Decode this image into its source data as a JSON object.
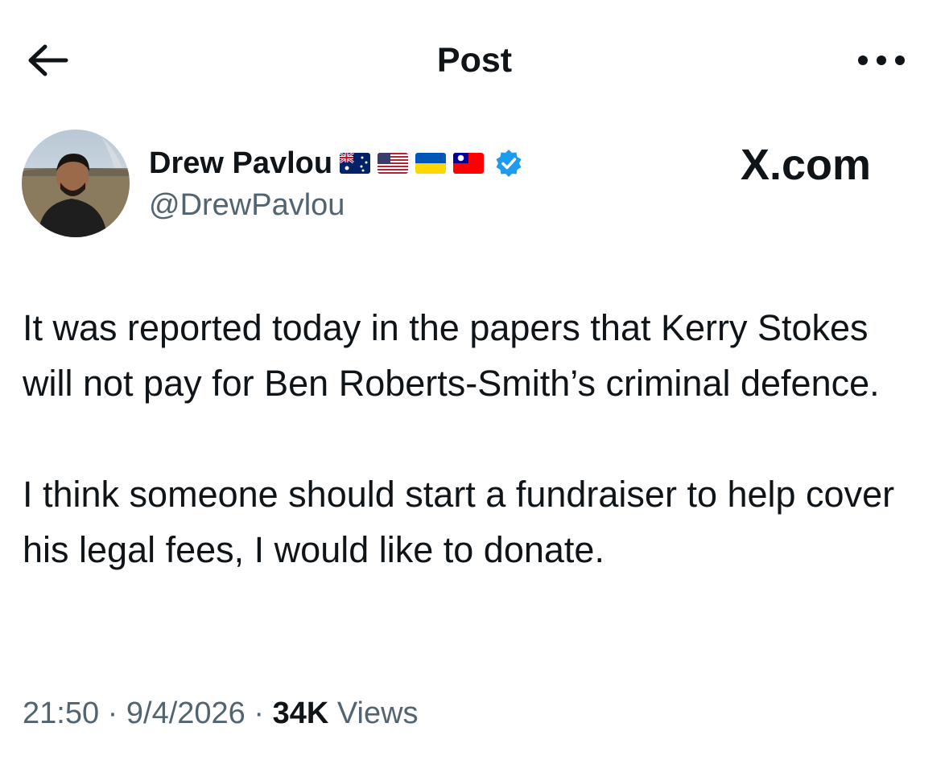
{
  "header": {
    "title": "Post",
    "back_icon": "arrow-left-icon",
    "more_icon": "more-horizontal-icon"
  },
  "author": {
    "name": "Drew Pavlou",
    "handle": "@DrewPavlou",
    "flags": [
      "australia-flag-icon",
      "usa-flag-icon",
      "ukraine-flag-icon",
      "taiwan-flag-icon"
    ],
    "verified_icon": "verified-badge-icon",
    "verified_color": "#1d9bf0"
  },
  "watermark": "X.com",
  "post": {
    "paragraphs": [
      "It was reported today in the papers that Kerry Stokes will not pay for Ben Roberts-Smith’s criminal defence.",
      "I think someone should start a fundraiser to help cover his legal fees, I would like to donate."
    ]
  },
  "meta": {
    "time": "21:50",
    "date": "9/4/2026",
    "views_count": "34K",
    "views_label": "Views",
    "separator": "·"
  },
  "colors": {
    "text": "#0f1419",
    "secondary_text": "#536471",
    "accent": "#1d9bf0"
  }
}
